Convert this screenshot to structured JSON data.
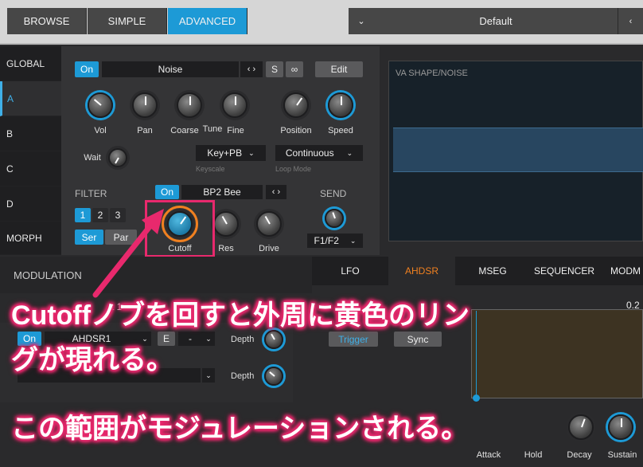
{
  "topbar": {
    "tabs": [
      "BROWSE",
      "SIMPLE",
      "ADVANCED"
    ],
    "preset_name": "Default",
    "prev_arrow": "⌄",
    "next_arrow": "‹"
  },
  "sidebar": {
    "items": [
      "GLOBAL",
      "A",
      "B",
      "C",
      "D",
      "MORPH"
    ]
  },
  "osc": {
    "on_label": "On",
    "noise_label": "Noise",
    "s_label": "S",
    "edit_label": "Edit",
    "knobs": [
      "Vol",
      "Pan",
      "Coarse",
      "Tune",
      "Fine",
      "Position",
      "Speed"
    ],
    "wait_label": "Wait",
    "keyscale_value": "Key+PB",
    "keyscale_label": "Keyscale",
    "loop_value": "Continuous",
    "loop_label": "Loop Mode"
  },
  "filter": {
    "title": "FILTER",
    "on_label": "On",
    "type_value": "BP2 Bee",
    "num_buttons": [
      "1",
      "2",
      "3"
    ],
    "ser_label": "Ser",
    "par_label": "Par",
    "knobs": [
      "Cutoff",
      "Res",
      "Drive"
    ]
  },
  "send": {
    "title": "SEND",
    "value": "F1/F2"
  },
  "viewer": {
    "title": "VA SHAPE/NOISE"
  },
  "modulation": {
    "title": "MODULATION",
    "tabs": [
      "LFO",
      "AHDSR",
      "MSEG",
      "SEQUENCER",
      "MODM"
    ],
    "row1_on": "On",
    "row1_source": "AHDSR1",
    "row1_e": "E",
    "row1_dash": "-",
    "depth_label": "Depth",
    "slot_fragment": "t 1",
    "trigger_label": "Trigger",
    "sync_label": "Sync",
    "value_fragment": "0.2",
    "env_labels": [
      "Attack",
      "Hold",
      "Decay",
      "Sustain"
    ]
  },
  "overlay": {
    "line1": "Cutoffノブを回すと外周に黄色のリン",
    "line2": "グが現れる。",
    "line3": "この範囲がモジュレーションされる。"
  },
  "colors": {
    "accent": "#1d9ad6",
    "highlight": "#e8296d",
    "ring": "#f08020"
  }
}
